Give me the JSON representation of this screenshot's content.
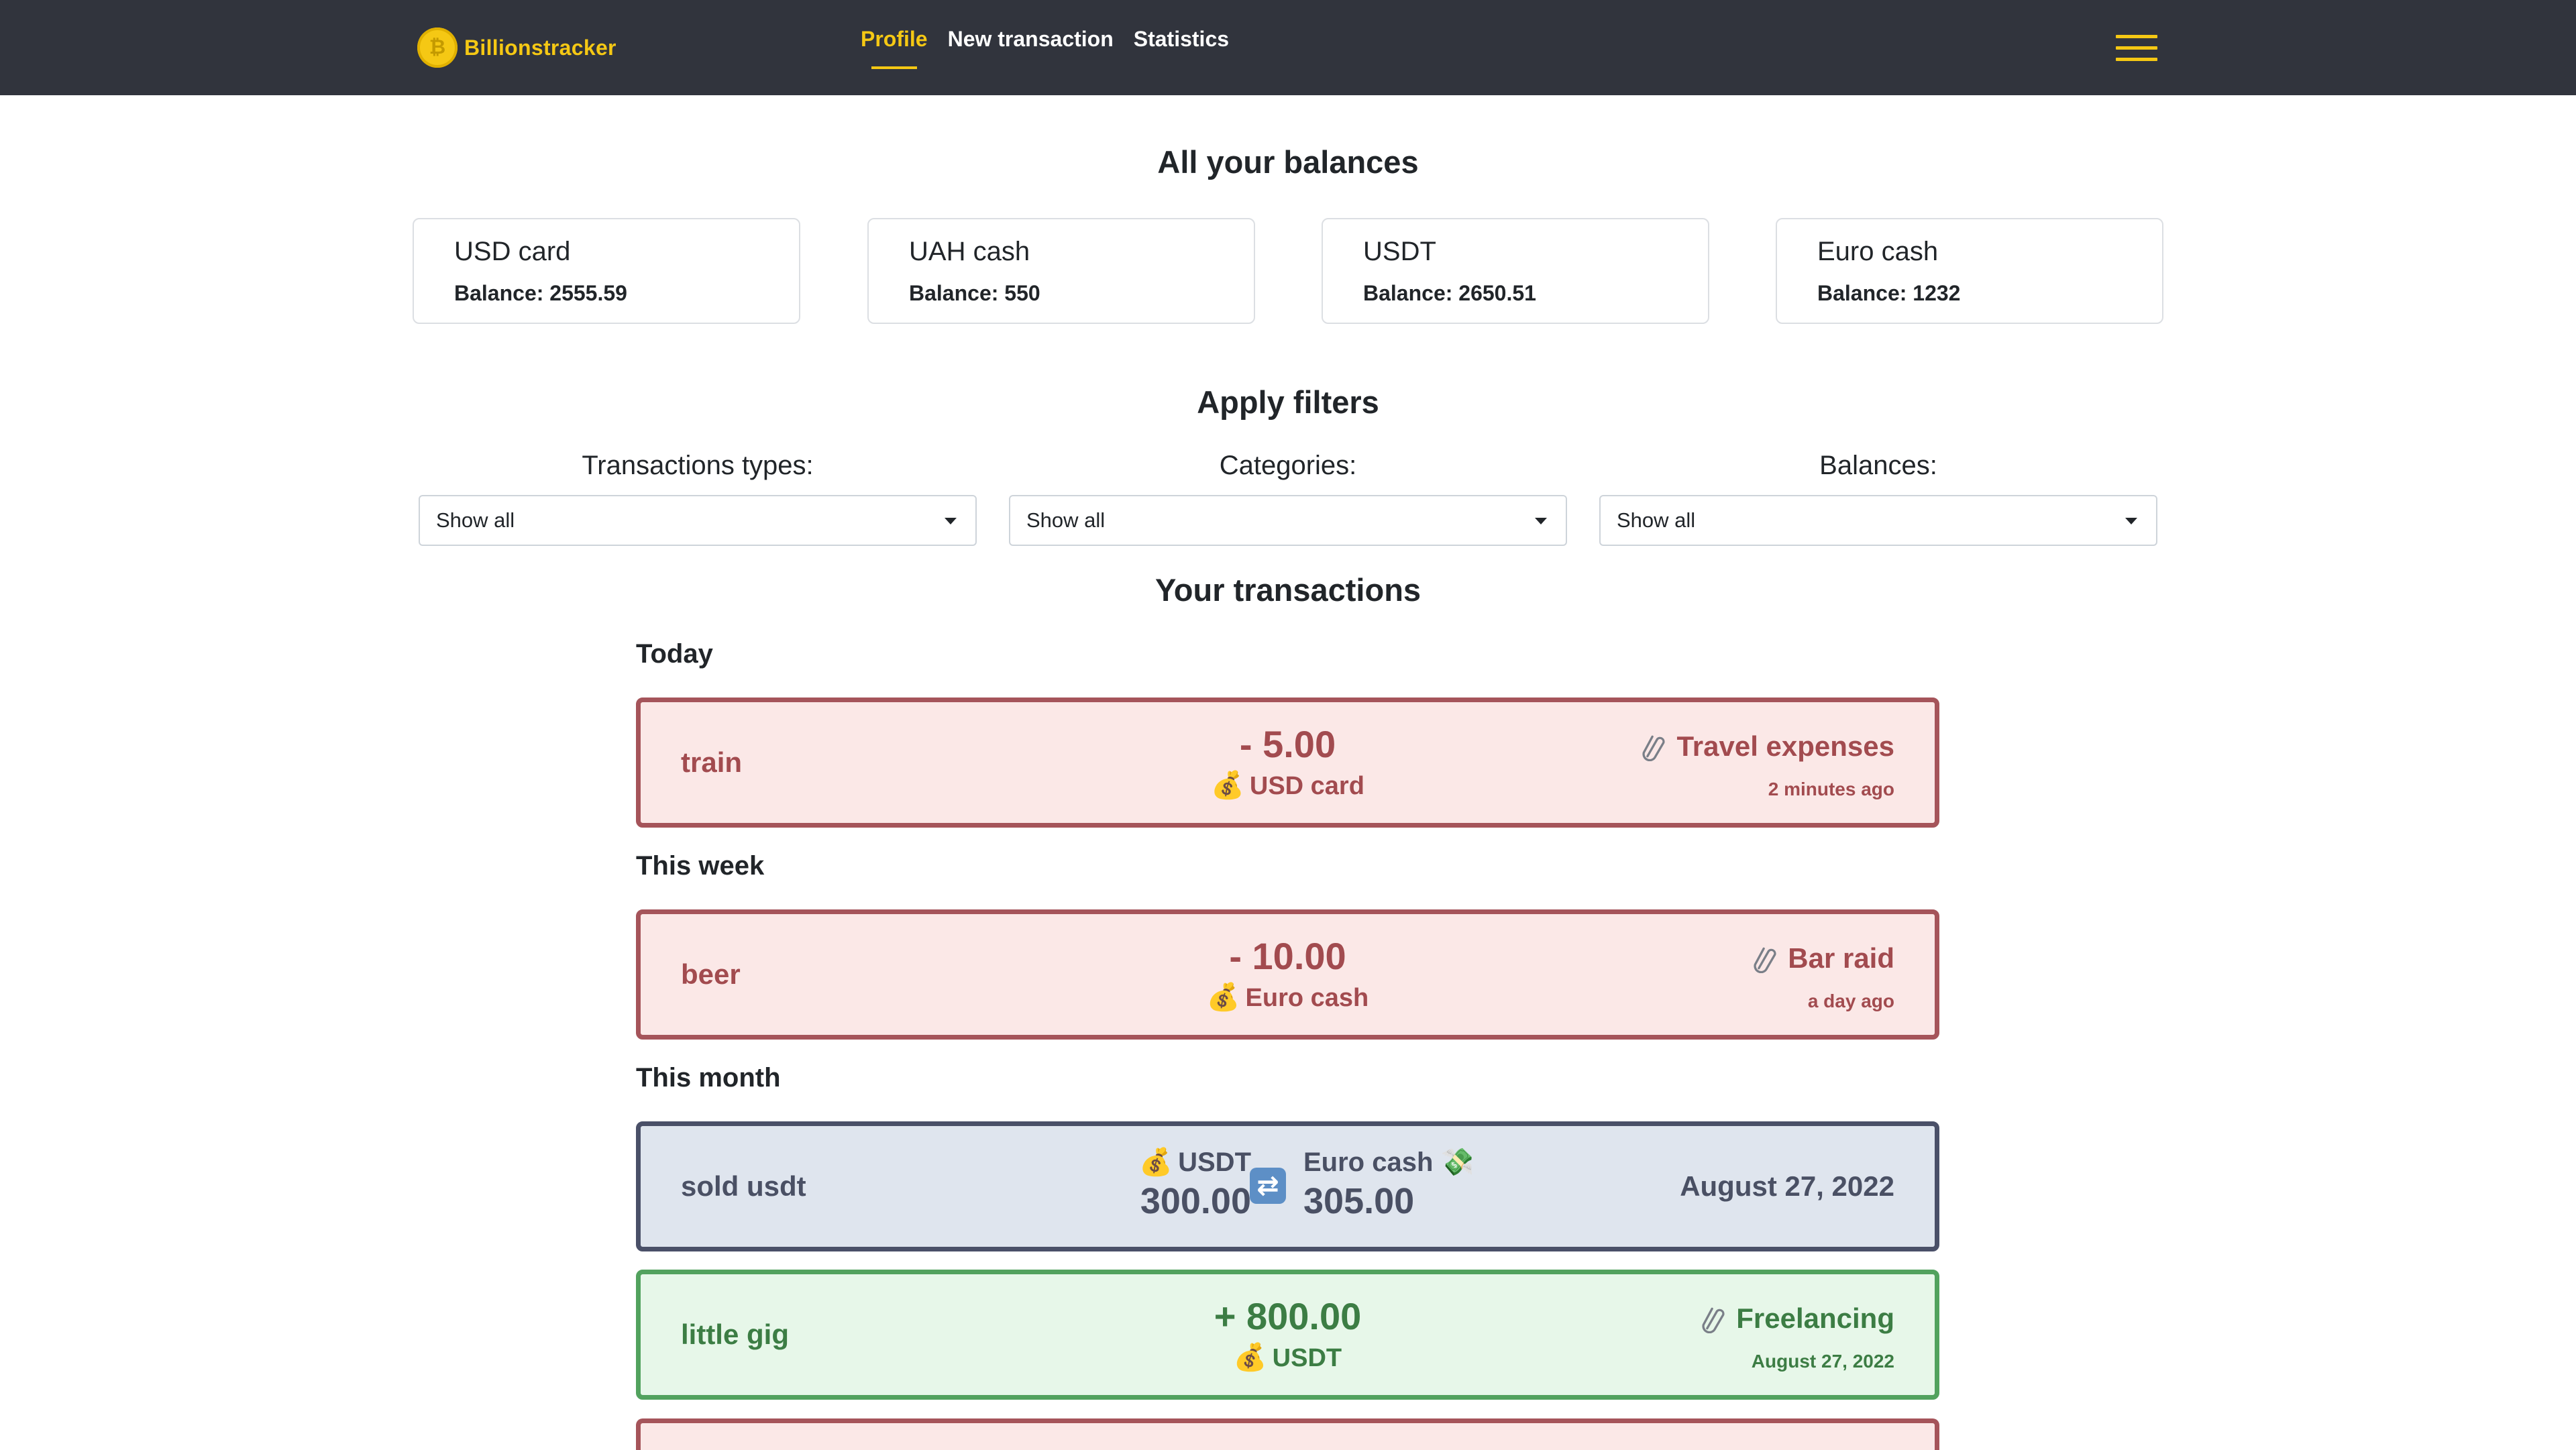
{
  "navbar": {
    "brand": "Billionstracker",
    "links": [
      "Profile",
      "New transaction",
      "Statistics"
    ]
  },
  "balances_section": {
    "title": "All your balances",
    "cards": [
      {
        "name": "USD card",
        "balance": "Balance: 2555.59"
      },
      {
        "name": "UAH cash",
        "balance": "Balance: 550"
      },
      {
        "name": "USDT",
        "balance": "Balance: 2650.51"
      },
      {
        "name": "Euro cash",
        "balance": "Balance: 1232"
      }
    ]
  },
  "filters": {
    "title": "Apply filters",
    "items": [
      {
        "label": "Transactions types:",
        "value": "Show all"
      },
      {
        "label": "Categories:",
        "value": "Show all"
      },
      {
        "label": "Balances:",
        "value": "Show all"
      }
    ]
  },
  "transactions": {
    "title": "Your transactions",
    "groups": [
      "Today",
      "This week",
      "This month"
    ],
    "items": [
      {
        "type": "expense",
        "title": "train",
        "amount": "- 5.00",
        "account": "USD card",
        "category": "Travel expenses",
        "when": "2 minutes ago"
      },
      {
        "type": "expense",
        "title": "beer",
        "amount": "- 10.00",
        "account": "Euro cash",
        "category": "Bar raid",
        "when": "a day ago"
      },
      {
        "type": "exchange",
        "title": "sold usdt",
        "from_account": "USDT",
        "from_amount": "300.00",
        "to_account": "Euro cash",
        "to_amount": "305.00",
        "date": "August 27, 2022"
      },
      {
        "type": "income",
        "title": "little gig",
        "amount": "+ 800.00",
        "account": "USDT",
        "category": "Freelancing",
        "when": "August 27, 2022"
      }
    ]
  },
  "colors": {
    "navbar_bg": "#31343d",
    "accent": "#f5c814",
    "expense_bg": "#fbe8e7",
    "expense_border": "#a5545a",
    "exchange_bg": "#dfe5ee",
    "exchange_border": "#4a5068",
    "income_bg": "#e7f7e9",
    "income_border": "#52a25e"
  },
  "icons": {
    "brand": "coin-icon",
    "menu": "hamburger-menu-icon",
    "account": "money-bag-icon",
    "category": "paperclip-icon",
    "exchange": "swap-icon",
    "money_wings": "money-with-wings-icon"
  }
}
